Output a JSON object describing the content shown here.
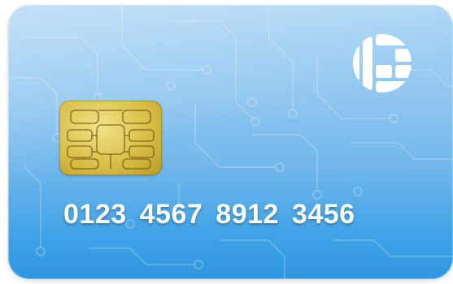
{
  "card": {
    "number_groups": [
      "0123",
      "4567",
      "8912",
      "3456"
    ]
  },
  "logo": {
    "icon": "globe-block-logo-icon"
  },
  "chip": {
    "icon": "emv-chip-icon"
  },
  "colors": {
    "card_top": "#a9d4f4",
    "card_bottom": "#2f97e0",
    "chip_gold": "#d9bf48",
    "number_text": "#ffffff"
  }
}
